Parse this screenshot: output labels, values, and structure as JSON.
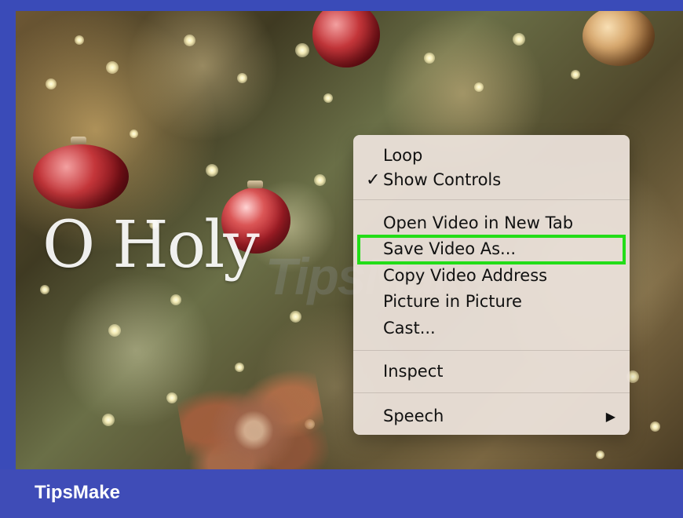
{
  "screen": {
    "overlay_text": "O Holy",
    "watermark": "TipsMake",
    "context_menu": {
      "items": [
        {
          "label": "Loop",
          "checked": false
        },
        {
          "label": "Show Controls",
          "checked": true
        },
        {
          "label": "Open Video in New Tab",
          "checked": false
        },
        {
          "label": "Save Video As...",
          "checked": false,
          "highlighted": true
        },
        {
          "label": "Copy Video Address",
          "checked": false
        },
        {
          "label": "Picture in Picture",
          "checked": false
        },
        {
          "label": "Cast...",
          "checked": false
        },
        {
          "label": "Inspect",
          "checked": false
        },
        {
          "label": "Speech",
          "checked": false,
          "submenu": true
        }
      ]
    },
    "footer": {
      "brand": "TipsMake"
    }
  },
  "colors": {
    "frame_border": "#3a4bb8",
    "highlight": "#23dd18",
    "footer": "#3f4cb7",
    "menu_bg": "#ece2db"
  },
  "icons": {
    "check": "checkmark-icon",
    "submenu": "submenu-arrow-icon"
  }
}
